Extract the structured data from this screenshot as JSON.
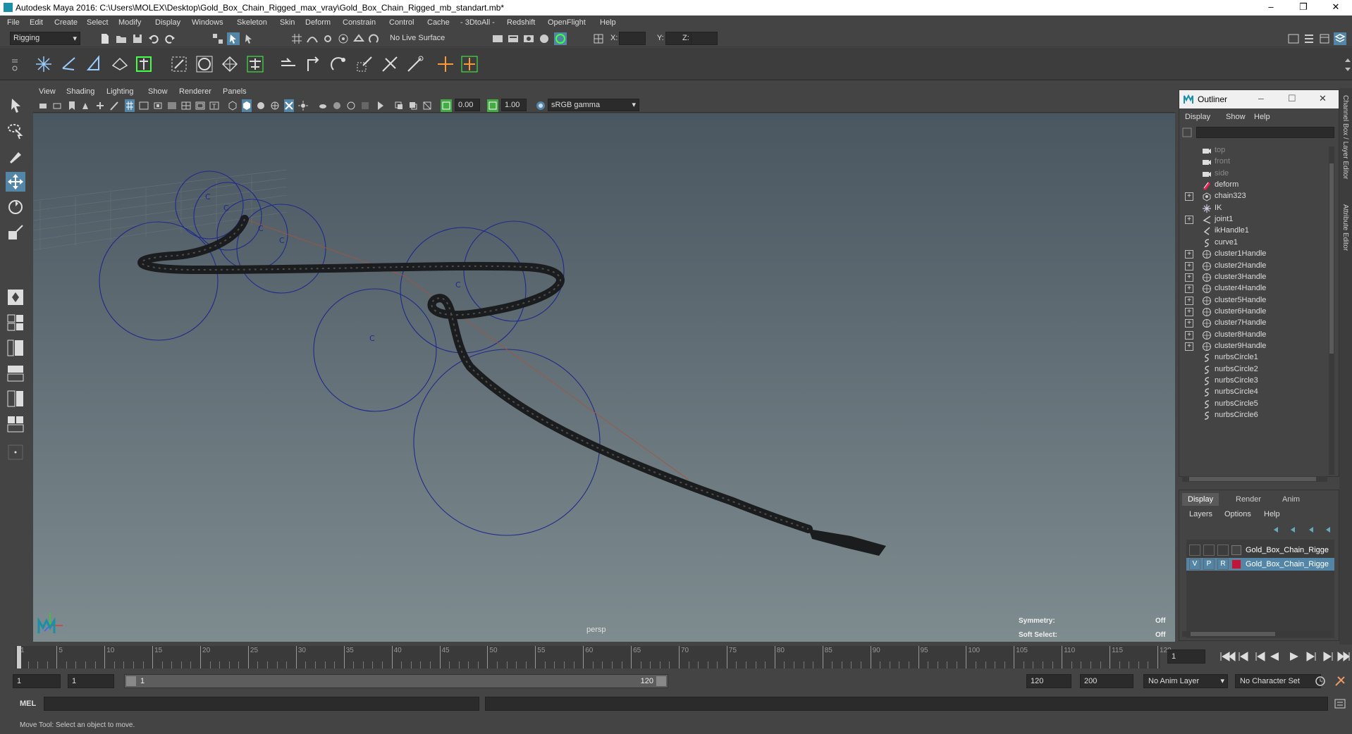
{
  "window": {
    "title": "Autodesk Maya 2016: C:\\Users\\MOLEX\\Desktop\\Gold_Box_Chain_Rigged_max_vray\\Gold_Box_Chain_Rigged_mb_standart.mb*",
    "minimize": "–",
    "maximize": "❐",
    "close": "✕"
  },
  "menubar": [
    "File",
    "Edit",
    "Create",
    "Select",
    "Modify",
    "Display",
    "Windows",
    "Skeleton",
    "Skin",
    "Deform",
    "Constrain",
    "Control",
    "Cache",
    "- 3DtoAll -",
    "Redshift",
    "OpenFlight",
    "Help"
  ],
  "statusline": {
    "menuset": "Rigging",
    "live_surface": "No Live Surface",
    "x_label": "X:",
    "y_label": "Y:",
    "z_label": "Z:"
  },
  "viewport": {
    "menu": [
      "View",
      "Shading",
      "Lighting",
      "Show",
      "Renderer",
      "Panels"
    ],
    "field1": "0.00",
    "field2": "1.00",
    "color_space": "sRGB gamma",
    "camera_label": "persp",
    "symmetry_label": "Symmetry:",
    "symmetry_value": "Off",
    "soft_select_label": "Soft Select:",
    "soft_select_value": "Off",
    "cluster_marker": "C"
  },
  "outliner": {
    "title": "Outliner",
    "menu": [
      "Display",
      "Show",
      "Help"
    ],
    "items": [
      {
        "label": "top",
        "expand": false,
        "icon": "camera-icon",
        "dim": true
      },
      {
        "label": "front",
        "expand": false,
        "icon": "camera-icon",
        "dim": true
      },
      {
        "label": "side",
        "expand": false,
        "icon": "camera-icon",
        "dim": true
      },
      {
        "label": "deform",
        "expand": false,
        "icon": "set-icon",
        "dim": false
      },
      {
        "label": "chain323",
        "expand": true,
        "icon": "mesh-icon",
        "dim": false
      },
      {
        "label": "IK",
        "expand": false,
        "icon": "locator-icon",
        "dim": false
      },
      {
        "label": "joint1",
        "expand": true,
        "icon": "joint-icon",
        "dim": false
      },
      {
        "label": "ikHandle1",
        "expand": false,
        "icon": "ikhandle-icon",
        "dim": false
      },
      {
        "label": "curve1",
        "expand": false,
        "icon": "curve-icon",
        "dim": false
      },
      {
        "label": "cluster1Handle",
        "expand": true,
        "icon": "cluster-icon",
        "dim": false
      },
      {
        "label": "cluster2Handle",
        "expand": true,
        "icon": "cluster-icon",
        "dim": false
      },
      {
        "label": "cluster3Handle",
        "expand": true,
        "icon": "cluster-icon",
        "dim": false
      },
      {
        "label": "cluster4Handle",
        "expand": true,
        "icon": "cluster-icon",
        "dim": false
      },
      {
        "label": "cluster5Handle",
        "expand": true,
        "icon": "cluster-icon",
        "dim": false
      },
      {
        "label": "cluster6Handle",
        "expand": true,
        "icon": "cluster-icon",
        "dim": false
      },
      {
        "label": "cluster7Handle",
        "expand": true,
        "icon": "cluster-icon",
        "dim": false
      },
      {
        "label": "cluster8Handle",
        "expand": true,
        "icon": "cluster-icon",
        "dim": false
      },
      {
        "label": "cluster9Handle",
        "expand": true,
        "icon": "cluster-icon",
        "dim": false
      },
      {
        "label": "nurbsCircle1",
        "expand": false,
        "icon": "curve-icon",
        "dim": false
      },
      {
        "label": "nurbsCircle2",
        "expand": false,
        "icon": "curve-icon",
        "dim": false
      },
      {
        "label": "nurbsCircle3",
        "expand": false,
        "icon": "curve-icon",
        "dim": false
      },
      {
        "label": "nurbsCircle4",
        "expand": false,
        "icon": "curve-icon",
        "dim": false
      },
      {
        "label": "nurbsCircle5",
        "expand": false,
        "icon": "curve-icon",
        "dim": false
      },
      {
        "label": "nurbsCircle6",
        "expand": false,
        "icon": "curve-icon",
        "dim": false
      }
    ]
  },
  "layers": {
    "tabs": [
      "Display",
      "Render",
      "Anim"
    ],
    "menu": [
      "Layers",
      "Options",
      "Help"
    ],
    "rows": [
      {
        "v": "",
        "p": "",
        "r": "",
        "name": "Gold_Box_Chain_Rigge",
        "color": "#444444",
        "selected": false
      },
      {
        "v": "V",
        "p": "P",
        "r": "R",
        "name": "Gold_Box_Chain_Rigge",
        "color": "#c0143c",
        "selected": true
      }
    ]
  },
  "sidetabs": [
    "Channel Box / Layer Editor",
    "Attribute Editor"
  ],
  "timeslider": {
    "ticks": [
      "1",
      "5",
      "10",
      "15",
      "20",
      "25",
      "30",
      "35",
      "40",
      "45",
      "50",
      "55",
      "60",
      "65",
      "70",
      "75",
      "80",
      "85",
      "90",
      "95",
      "100",
      "105",
      "110",
      "115",
      "120"
    ],
    "current_frame": "1"
  },
  "rangeslider": {
    "start": "1",
    "playback_start": "1",
    "range_start_label": "1",
    "range_end_label": "120",
    "playback_end": "120",
    "end": "200",
    "anim_layer": "No Anim Layer",
    "character_set": "No Character Set"
  },
  "cmdline": {
    "label": "MEL"
  },
  "helpline": {
    "text": "Move Tool: Select an object to move."
  },
  "colors": {
    "accent": "#5285a6",
    "selected_layer": "#5285a6",
    "layer_red": "#c0143c",
    "circle_blue": "#1f2a8a"
  }
}
